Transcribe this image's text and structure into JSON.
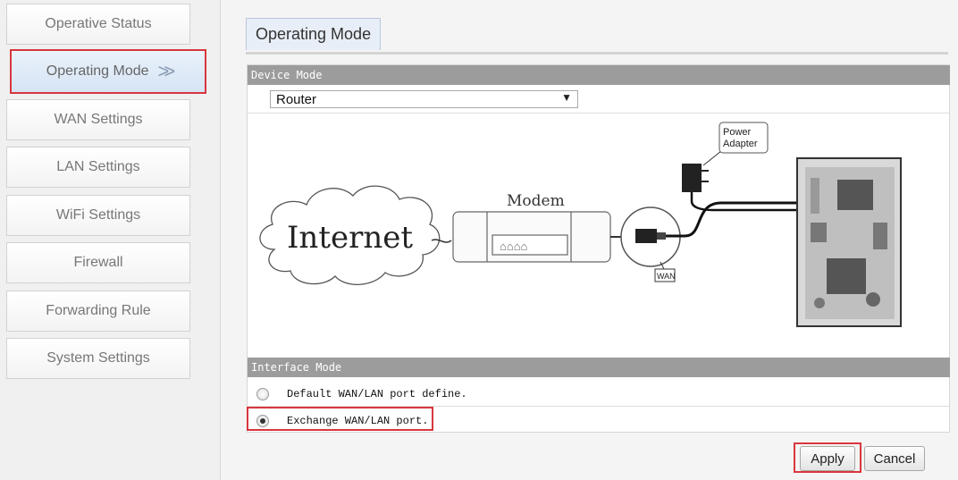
{
  "sidebar": {
    "items": [
      {
        "label": "Operative Status"
      },
      {
        "label": "Operating Mode",
        "active_marker": ">>"
      },
      {
        "label": "WAN Settings"
      },
      {
        "label": "LAN Settings"
      },
      {
        "label": "WiFi Settings"
      },
      {
        "label": "Firewall"
      },
      {
        "label": "Forwarding Rule"
      },
      {
        "label": "System Settings"
      }
    ]
  },
  "main": {
    "tab_title": "Operating Mode",
    "device_mode": {
      "header": "Device Mode",
      "selected": "Router"
    },
    "diagram": {
      "internet": "Internet",
      "modem": "Modem",
      "power_adapter": [
        "Power",
        "Adapter"
      ],
      "wan": "WAN"
    },
    "interface_mode": {
      "header": "Interface Mode",
      "options": [
        {
          "label": "Default WAN/LAN port define.",
          "checked": false
        },
        {
          "label": "Exchange WAN/LAN port.",
          "checked": true
        }
      ]
    },
    "buttons": {
      "apply": "Apply",
      "cancel": "Cancel"
    }
  },
  "colors": {
    "highlight": "#d9363e",
    "section_header": "#9c9c9c",
    "active_tab": "#e8eef7"
  }
}
